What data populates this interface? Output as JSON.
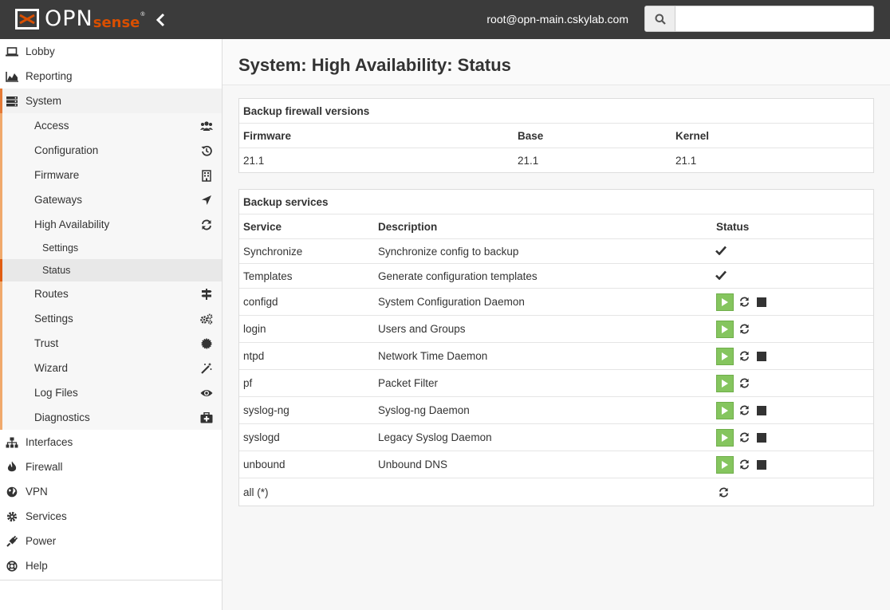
{
  "header": {
    "logo_main": "OPN",
    "logo_accent": "sense",
    "logo_mark": "®",
    "user": "root@opn-main.cskylab.com",
    "search_placeholder": ""
  },
  "sidebar": {
    "top_items": [
      {
        "label": "Lobby",
        "icon": "laptop-icon"
      },
      {
        "label": "Reporting",
        "icon": "area-chart-icon"
      },
      {
        "label": "System",
        "icon": "server-icon"
      }
    ],
    "system_items": [
      {
        "label": "Access",
        "icon": "users-icon"
      },
      {
        "label": "Configuration",
        "icon": "history-icon"
      },
      {
        "label": "Firmware",
        "icon": "building-icon"
      },
      {
        "label": "Gateways",
        "icon": "location-arrow-icon"
      },
      {
        "label": "High Availability",
        "icon": "refresh-icon"
      }
    ],
    "ha_items": [
      {
        "label": "Settings"
      },
      {
        "label": "Status"
      }
    ],
    "system_items_after": [
      {
        "label": "Routes",
        "icon": "map-signs-icon"
      },
      {
        "label": "Settings",
        "icon": "cogs-icon"
      },
      {
        "label": "Trust",
        "icon": "certificate-icon"
      },
      {
        "label": "Wizard",
        "icon": "magic-icon"
      },
      {
        "label": "Log Files",
        "icon": "eye-icon"
      },
      {
        "label": "Diagnostics",
        "icon": "medkit-icon"
      }
    ],
    "bottom_items": [
      {
        "label": "Interfaces",
        "icon": "sitemap-icon"
      },
      {
        "label": "Firewall",
        "icon": "fire-icon"
      },
      {
        "label": "VPN",
        "icon": "globe-icon"
      },
      {
        "label": "Services",
        "icon": "cog-icon"
      },
      {
        "label": "Power",
        "icon": "plug-icon"
      },
      {
        "label": "Help",
        "icon": "life-ring-icon"
      }
    ]
  },
  "page": {
    "title": "System: High Availability: Status"
  },
  "versions": {
    "title": "Backup firewall versions",
    "columns": [
      "Firmware",
      "Base",
      "Kernel"
    ],
    "values": [
      "21.1",
      "21.1",
      "21.1"
    ]
  },
  "services": {
    "title": "Backup services",
    "columns": [
      "Service",
      "Description",
      "Status"
    ],
    "rows": [
      {
        "service": "Synchronize",
        "description": "Synchronize config to backup",
        "status": "check"
      },
      {
        "service": "Templates",
        "description": "Generate configuration templates",
        "status": "check"
      },
      {
        "service": "configd",
        "description": "System Configuration Daemon",
        "status": "play-restart-stop"
      },
      {
        "service": "login",
        "description": "Users and Groups",
        "status": "play-restart"
      },
      {
        "service": "ntpd",
        "description": "Network Time Daemon",
        "status": "play-restart-stop"
      },
      {
        "service": "pf",
        "description": "Packet Filter",
        "status": "play-restart"
      },
      {
        "service": "syslog-ng",
        "description": "Syslog-ng Daemon",
        "status": "play-restart-stop"
      },
      {
        "service": "syslogd",
        "description": "Legacy Syslog Daemon",
        "status": "play-restart-stop"
      },
      {
        "service": "unbound",
        "description": "Unbound DNS",
        "status": "play-restart-stop"
      },
      {
        "service": "all (*)",
        "description": "",
        "status": "restart"
      }
    ]
  },
  "colors": {
    "topbar": "#3b3b3b",
    "accent": "#e05d12",
    "play": "#85c55e"
  }
}
